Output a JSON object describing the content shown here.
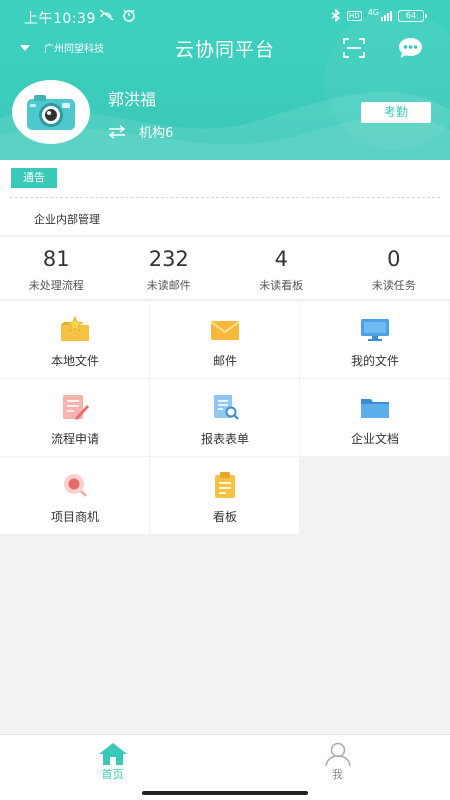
{
  "status_bar": {
    "time": "上午10:39",
    "network": "4G",
    "hd": "HD",
    "battery": "64"
  },
  "header": {
    "company": "广州同望科技",
    "title": "云协同平台",
    "user_name": "郭洪福",
    "org": "机构6",
    "attend_label": "考勤"
  },
  "notice": {
    "badge": "通告",
    "text": "企业内部管理"
  },
  "stats": [
    {
      "value": "81",
      "label": "未处理流程"
    },
    {
      "value": "232",
      "label": "未读邮件"
    },
    {
      "value": "4",
      "label": "未读看板"
    },
    {
      "value": "0",
      "label": "未读任务"
    }
  ],
  "grid": [
    {
      "label": "本地文件",
      "icon": "star-folder-icon"
    },
    {
      "label": "邮件",
      "icon": "mail-icon"
    },
    {
      "label": "我的文件",
      "icon": "monitor-icon"
    },
    {
      "label": "流程申请",
      "icon": "form-edit-icon"
    },
    {
      "label": "报表表单",
      "icon": "report-search-icon"
    },
    {
      "label": "企业文档",
      "icon": "folder-icon"
    },
    {
      "label": "项目商机",
      "icon": "project-opportunity-icon"
    },
    {
      "label": "看板",
      "icon": "clipboard-icon"
    }
  ],
  "bottom_nav": [
    {
      "label": "首页",
      "icon": "home-icon",
      "active": true
    },
    {
      "label": "我",
      "icon": "person-icon",
      "active": false
    }
  ],
  "colors": {
    "accent": "#3ac8b8",
    "mail_yellow": "#f6c244",
    "blue": "#4aa3e6",
    "red": "#e96a6a"
  }
}
